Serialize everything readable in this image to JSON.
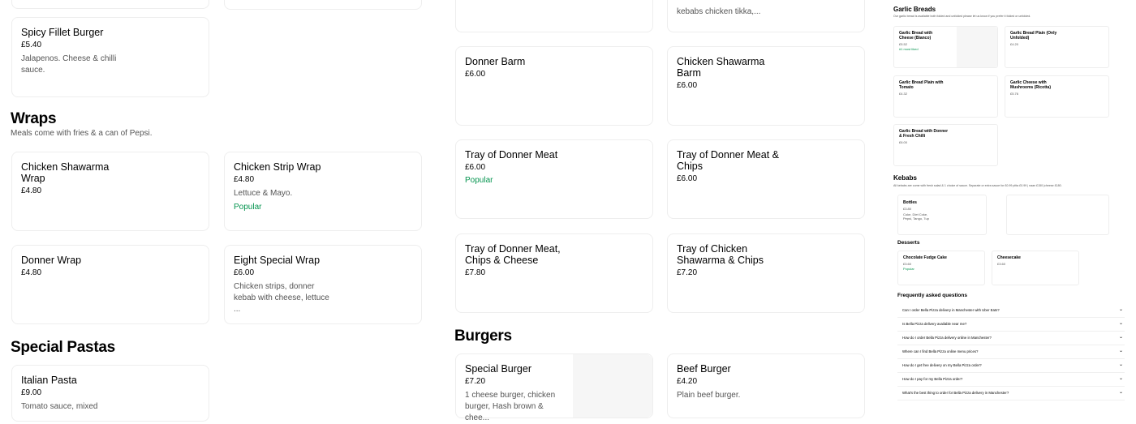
{
  "left": {
    "top_items": [
      {
        "name": "Spicy Fillet Burger",
        "price": "£5.40",
        "desc": "Jalapenos. Cheese & chilli sauce."
      }
    ],
    "wraps": {
      "title": "Wraps",
      "subtitle": "Meals come with fries & a can of Pepsi.",
      "items": [
        {
          "name": "Chicken Shawarma Wrap",
          "price": "£4.80"
        },
        {
          "name": "Chicken Strip Wrap",
          "price": "£4.80",
          "desc": "Lettuce & Mayo.",
          "popular": "Popular"
        },
        {
          "name": "Donner Wrap",
          "price": "£4.80"
        },
        {
          "name": "Eight Special Wrap",
          "price": "£6.00",
          "desc": "Chicken strips, donner kebab with cheese, lettuce ..."
        }
      ]
    },
    "pastas": {
      "title": "Special Pastas",
      "items": [
        {
          "name": "Italian Pasta",
          "price": "£9.00",
          "desc": "Tomato sauce, mixed"
        }
      ]
    }
  },
  "middle": {
    "top_desc": "kebabs chicken tikka,...",
    "items": [
      {
        "name": "Donner Barm",
        "price": "£6.00"
      },
      {
        "name": "Chicken Shawarma Barm",
        "price": "£6.00"
      },
      {
        "name": "Tray of Donner Meat",
        "price": "£6.00",
        "popular": "Popular"
      },
      {
        "name": "Tray of Donner Meat & Chips",
        "price": "£6.00"
      },
      {
        "name": "Tray of Donner Meat, Chips & Cheese",
        "price": "£7.80"
      },
      {
        "name": "Tray of Chicken Shawarma & Chips",
        "price": "£7.20"
      }
    ],
    "burgers": {
      "title": "Burgers",
      "items": [
        {
          "name": "Special Burger",
          "price": "£7.20",
          "desc": "1 cheese burger, chicken burger, Hash brown & chee..."
        },
        {
          "name": "Beef Burger",
          "price": "£4.20",
          "desc": "Plain beef burger."
        }
      ]
    }
  },
  "right": {
    "garlic": {
      "title": "Garlic Breads",
      "subtitle": "Our garlic bread is available both folded and unfolded please let us know if you prefer it folded or unfolded.",
      "items": [
        {
          "name": "Garlic Bread with Cheese (Bianco)",
          "price": "£5.52",
          "popular": "#1 most liked"
        },
        {
          "name": "Garlic Bread Plain (Only Unfolded)",
          "price": "£4.20"
        },
        {
          "name": "Garlic Bread Plain with Tomato",
          "price": "£4.32"
        },
        {
          "name": "Garlic Cheese with Mushrooms (Ricotta)",
          "price": "£5.76"
        },
        {
          "name": "Garlic Bread with Donner & Fresh Chilli",
          "price": "£6.00"
        }
      ]
    },
    "kebabs": {
      "title": "Kebabs",
      "subtitle": "All kebabs are come with fresh salad & 1 choice of sauce. Separate or extra sauce for £0.99 pitta £0.99 | naan £150 |cheese £180.",
      "item": {
        "name": "Bottles",
        "price": "£3.80",
        "desc": "Coke, Diet Coke, Pepsi, Tango, 7up"
      }
    },
    "desserts": {
      "title": "Desserts",
      "items": [
        {
          "name": "Chocolate Fudge Cake",
          "price": "£3.60",
          "popular": "Popular"
        },
        {
          "name": "Cheesecake",
          "price": "£3.60"
        }
      ]
    },
    "faq": {
      "title": "Frequently asked questions",
      "items": [
        "Can I order Bella Pizza delivery in Manchester with Uber Eats?",
        "Is Bella Pizza delivery available near me?",
        "How do I order Bella Pizza delivery online in Manchester?",
        "Where can I find Bella Pizza online menu prices?",
        "How do I get free delivery on my Bella Pizza order?",
        "How do I pay for my Bella Pizza order?",
        "What's the best thing to order for Bella Pizza delivery in Manchester?"
      ],
      "chevron": "chevron-down-icon"
    }
  }
}
